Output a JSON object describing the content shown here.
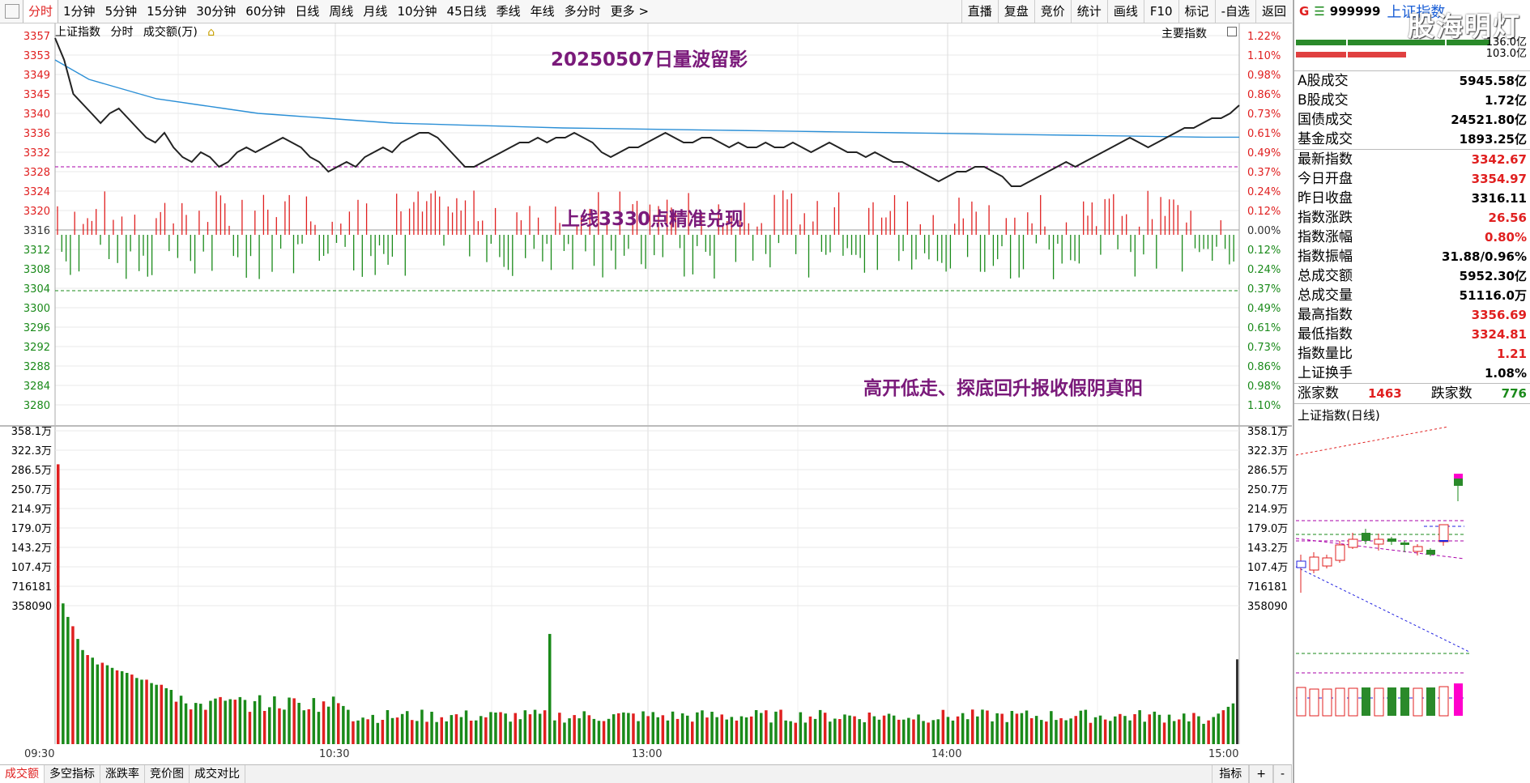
{
  "toolbar": {
    "periods": [
      "分时",
      "1分钟",
      "5分钟",
      "15分钟",
      "30分钟",
      "60分钟",
      "日线",
      "周线",
      "月线",
      "10分钟",
      "45日线",
      "季线",
      "年线",
      "多分时",
      "更多 >"
    ],
    "active_period": "分时",
    "right_tools": [
      "直播",
      "复盘",
      "竞价",
      "统计",
      "画线",
      "F10",
      "标记",
      "-自选",
      "返回"
    ]
  },
  "chart_header": {
    "index_name": "上证指数",
    "mode": "分时",
    "volume_unit": "成交额(万)",
    "main_indicator": "主要指数"
  },
  "annotations": {
    "title": "20250507日量波留影",
    "line_note": "上线3330点精准兑现",
    "summary": "高开低走、探底回升报收假阴真阳"
  },
  "colors": {
    "up": "#e02020",
    "down": "#1a8a1a",
    "price_line": "#222222",
    "avg_line": "#2b8fd6",
    "annotation": "#7a1a7a",
    "dashed_red": "#e02020",
    "dashed_green": "#1a8a1a",
    "dashed_purple": "#aa00aa",
    "dashed_blue": "#2020e0"
  },
  "chart_data": {
    "type": "line",
    "x_ticks": [
      "09:30",
      "10:30",
      "13:00",
      "14:00",
      "15:00"
    ],
    "prev_close": 3316.11,
    "y_left_ticks": [
      "3357",
      "3353",
      "3349",
      "3345",
      "3340",
      "3336",
      "3332",
      "3328",
      "3324",
      "3320",
      "3316",
      "3312",
      "3308",
      "3304",
      "3300",
      "3296",
      "3292",
      "3288",
      "3284",
      "3280"
    ],
    "y_right_ticks": [
      "1.22%",
      "1.10%",
      "0.98%",
      "0.86%",
      "0.73%",
      "0.61%",
      "0.49%",
      "0.37%",
      "0.24%",
      "0.12%",
      "0.00%",
      "0.12%",
      "0.24%",
      "0.37%",
      "0.49%",
      "0.61%",
      "0.73%",
      "0.86%",
      "0.98%",
      "1.10%"
    ],
    "price_series": [
      3356.5,
      3352,
      3345,
      3343,
      3341,
      3339,
      3341,
      3342,
      3340,
      3338,
      3336,
      3335,
      3337,
      3334,
      3332,
      3331,
      3333,
      3332,
      3330,
      3331,
      3333,
      3334,
      3333,
      3334,
      3335,
      3336,
      3335,
      3334,
      3332,
      3331,
      3329,
      3330,
      3331,
      3330,
      3332,
      3333,
      3334,
      3333,
      3335,
      3336,
      3337,
      3337,
      3336,
      3334,
      3332,
      3330,
      3330,
      3331,
      3332,
      3333,
      3334,
      3335,
      3335,
      3336,
      3335,
      3336,
      3336,
      3337,
      3336,
      3335,
      3333,
      3332,
      3333,
      3334,
      3334,
      3335,
      3336,
      3337,
      3336,
      3335,
      3335,
      3336,
      3336,
      3335,
      3334,
      3335,
      3334,
      3334,
      3335,
      3334,
      3334,
      3335,
      3334,
      3333,
      3334,
      3335,
      3334,
      3333,
      3333,
      3332,
      3333,
      3332,
      3331,
      3331,
      3330,
      3329,
      3328,
      3327,
      3328,
      3329,
      3329,
      3330,
      3330,
      3329,
      3328,
      3326,
      3326,
      3327,
      3328,
      3329,
      3330,
      3331,
      3330,
      3331,
      3332,
      3333,
      3334,
      3335,
      3336,
      3335,
      3334,
      3335,
      3336,
      3337,
      3338,
      3338,
      3339,
      3340,
      3340,
      3341,
      3342.67
    ],
    "avg_series": [
      3352,
      3348,
      3346,
      3344,
      3343,
      3342,
      3341,
      3340.5,
      3340,
      3339.5,
      3339,
      3338.8,
      3338.6,
      3338.4,
      3338.2,
      3338,
      3337.9,
      3337.8,
      3337.7,
      3337.6,
      3337.5,
      3337.4,
      3337.3,
      3337.2,
      3337.1,
      3337,
      3336.9,
      3336.8,
      3336.7,
      3336.6,
      3336.5,
      3336.4,
      3336.3,
      3336.2,
      3336.1,
      3336.1
    ],
    "volume_ticks_left": [
      "358.1万",
      "322.3万",
      "286.5万",
      "250.7万",
      "214.9万",
      "179.0万",
      "143.2万",
      "107.4万",
      "716181",
      "358090"
    ],
    "volume_ticks_right": [
      "358.1万",
      "322.3万",
      "286.5万",
      "250.7万",
      "214.9万",
      "179.0万",
      "143.2万",
      "107.4万",
      "716181",
      "358090"
    ]
  },
  "bottom_tabs": [
    "成交额",
    "多空指标",
    "涨跌率",
    "竞价图",
    "成交对比"
  ],
  "bottom_right": [
    "指标",
    "+",
    "-"
  ],
  "side_panel": {
    "tag": "G",
    "menu_icon": "☰",
    "code": "999999",
    "name": "上证指数",
    "watermark": "股海明灯",
    "bar_top_value": "136.0亿",
    "bar_bottom_value": "103.0亿",
    "rows1": [
      {
        "label": "A股成交",
        "value": "5945.58亿"
      },
      {
        "label": "B股成交",
        "value": "1.72亿"
      },
      {
        "label": "国债成交",
        "value": "24521.80亿"
      },
      {
        "label": "基金成交",
        "value": "1893.25亿"
      }
    ],
    "rows2": [
      {
        "label": "最新指数",
        "value": "3342.67",
        "color": "red"
      },
      {
        "label": "今日开盘",
        "value": "3354.97",
        "color": "red"
      },
      {
        "label": "昨日收盘",
        "value": "3316.11",
        "color": "black"
      },
      {
        "label": "指数涨跌",
        "value": "26.56",
        "color": "red"
      },
      {
        "label": "指数涨幅",
        "value": "0.80%",
        "color": "red"
      },
      {
        "label": "指数振幅",
        "value": "31.88/0.96%",
        "color": "black"
      },
      {
        "label": "总成交额",
        "value": "5952.30亿",
        "color": "black"
      },
      {
        "label": "总成交量",
        "value": "51116.0万",
        "color": "black"
      },
      {
        "label": "最高指数",
        "value": "3356.69",
        "color": "red"
      },
      {
        "label": "最低指数",
        "value": "3324.81",
        "color": "red"
      },
      {
        "label": "指数量比",
        "value": "1.21",
        "color": "red"
      },
      {
        "label": "上证换手",
        "value": "1.08%",
        "color": "black"
      }
    ],
    "up_label": "涨家数",
    "up_count": "1463",
    "down_label": "跌家数",
    "down_count": "776",
    "kline_title": "上证指数(日线)"
  }
}
